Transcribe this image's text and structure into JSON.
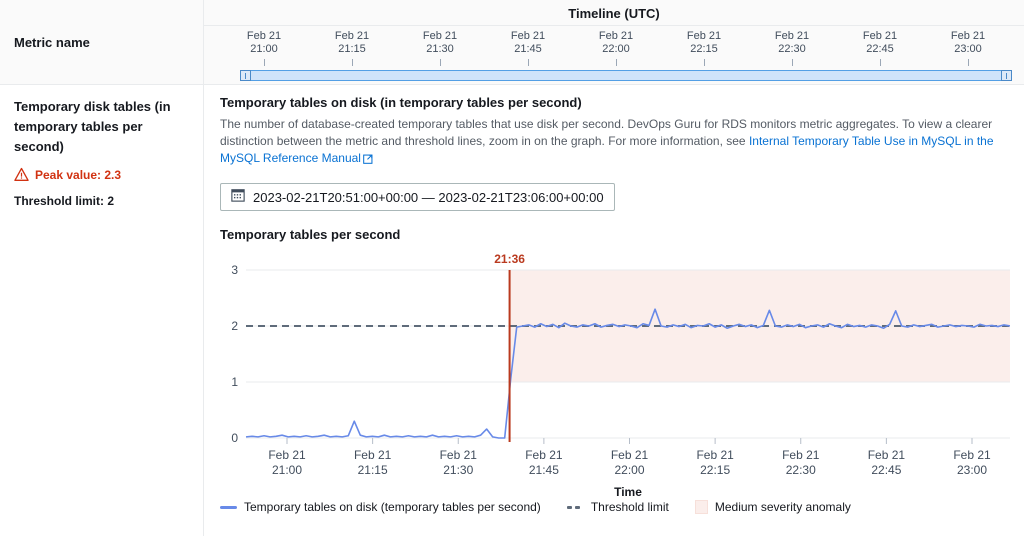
{
  "left_panel": {
    "header_label": "Metric name",
    "metric_title": "Temporary disk tables (in temporary tables per second)",
    "warn_icon": "warning-triangle-icon",
    "peak_value": "Peak value: 2.3",
    "threshold_limit": "Threshold limit: 2"
  },
  "timeline": {
    "title": "Timeline (UTC)",
    "ticks": [
      {
        "date": "Feb 21",
        "time": "21:00"
      },
      {
        "date": "Feb 21",
        "time": "21:15"
      },
      {
        "date": "Feb 21",
        "time": "21:30"
      },
      {
        "date": "Feb 21",
        "time": "21:45"
      },
      {
        "date": "Feb 21",
        "time": "22:00"
      },
      {
        "date": "Feb 21",
        "time": "22:15"
      },
      {
        "date": "Feb 21",
        "time": "22:30"
      },
      {
        "date": "Feb 21",
        "time": "22:45"
      },
      {
        "date": "Feb 21",
        "time": "23:00"
      }
    ],
    "slider": {
      "left_handle_icon": "slider-handle-left",
      "right_handle_icon": "slider-handle-right"
    }
  },
  "panel": {
    "title": "Temporary tables on disk (in temporary tables per second)",
    "description_part1": "The number of database-created temporary tables that use disk per second. DevOps Guru for RDS monitors metric aggregates. To view a clearer distinction between the metric and threshold lines, zoom in on the graph. For more information, see ",
    "link_text": "Internal Temporary Table Use in MySQL in the MySQL Reference Manual",
    "link_icon": "external-link-icon"
  },
  "date_range": {
    "icon": "calendar-icon",
    "value": "2023-02-21T20:51:00+00:00 — 2023-02-21T23:06:00+00:00"
  },
  "colors": {
    "series_line": "#688ae8",
    "threshold_line": "#5f6b7a",
    "anomaly_band": "#fbeeeb",
    "anomaly_marker": "#ba3a1f",
    "link": "#0972d3",
    "alert": "#d13212"
  },
  "legend": [
    {
      "label": "Temporary tables on disk (temporary tables per second)",
      "swatch": "line"
    },
    {
      "label": "Threshold limit",
      "swatch": "dashed"
    },
    {
      "label": "Medium severity anomaly",
      "swatch": "band"
    }
  ],
  "chart_data": {
    "type": "line",
    "title": "Temporary tables per second",
    "xlabel": "Time",
    "ylabel": "",
    "ylim": [
      0,
      3
    ],
    "yticks": [
      0,
      1,
      2,
      3
    ],
    "grid": true,
    "legend_position": "bottom",
    "xtick_labels": [
      "Feb 21 21:00",
      "Feb 21 21:15",
      "Feb 21 21:30",
      "Feb 21 21:45",
      "Feb 21 22:00",
      "Feb 21 22:15",
      "Feb 21 22:30",
      "Feb 21 22:45",
      "Feb 21 23:00"
    ],
    "x_start": "2023-02-21T20:51:00+00:00",
    "x_end": "2023-02-21T23:06:00+00:00",
    "threshold": {
      "label": "Threshold limit",
      "value": 2
    },
    "annotation": {
      "label": "21:36",
      "x_time": "21:36",
      "type": "anomaly-start-marker"
    },
    "anomaly_band": {
      "label": "Medium severity anomaly",
      "start": "21:36",
      "end": "23:06",
      "y_from": 1,
      "y_to": 3
    },
    "peak_value": 2.3,
    "series": [
      {
        "name": "Temporary tables on disk (temporary tables per second)",
        "values": [
          0.02,
          0.03,
          0.02,
          0.04,
          0.02,
          0.03,
          0.05,
          0.02,
          0.03,
          0.02,
          0.04,
          0.02,
          0.03,
          0.05,
          0.02,
          0.03,
          0.02,
          0.04,
          0.3,
          0.05,
          0.02,
          0.03,
          0.02,
          0.05,
          0.02,
          0.03,
          0.02,
          0.04,
          0.02,
          0.03,
          0.02,
          0.05,
          0.02,
          0.03,
          0.02,
          0.04,
          0.02,
          0.03,
          0.02,
          0.05,
          0.16,
          0.02,
          0.0,
          0.0,
          1.05,
          1.98,
          2.0,
          2.02,
          1.98,
          2.04,
          1.99,
          2.03,
          1.97,
          2.05,
          2.0,
          1.98,
          2.02,
          2.0,
          2.04,
          1.98,
          2.01,
          2.03,
          1.99,
          2.02,
          2.0,
          1.97,
          2.04,
          2.01,
          2.3,
          2.0,
          1.98,
          2.02,
          1.99,
          2.03,
          1.97,
          2.01,
          2.0,
          2.04,
          1.98,
          2.02,
          1.96,
          2.0,
          2.03,
          1.99,
          2.02,
          1.97,
          2.01,
          2.28,
          2.0,
          1.98,
          2.02,
          1.99,
          2.03,
          1.97,
          2.0,
          2.02,
          1.98,
          2.04,
          2.0,
          1.97,
          2.03,
          1.99,
          2.01,
          1.98,
          2.02,
          2.0,
          1.96,
          2.03,
          2.27,
          2.0,
          1.98,
          2.02,
          1.99,
          2.01,
          2.03,
          1.98,
          2.0,
          2.02,
          1.99,
          2.01,
          2.0,
          1.98,
          2.03,
          2.0,
          2.01,
          1.99,
          2.02,
          2.0
        ]
      }
    ]
  }
}
